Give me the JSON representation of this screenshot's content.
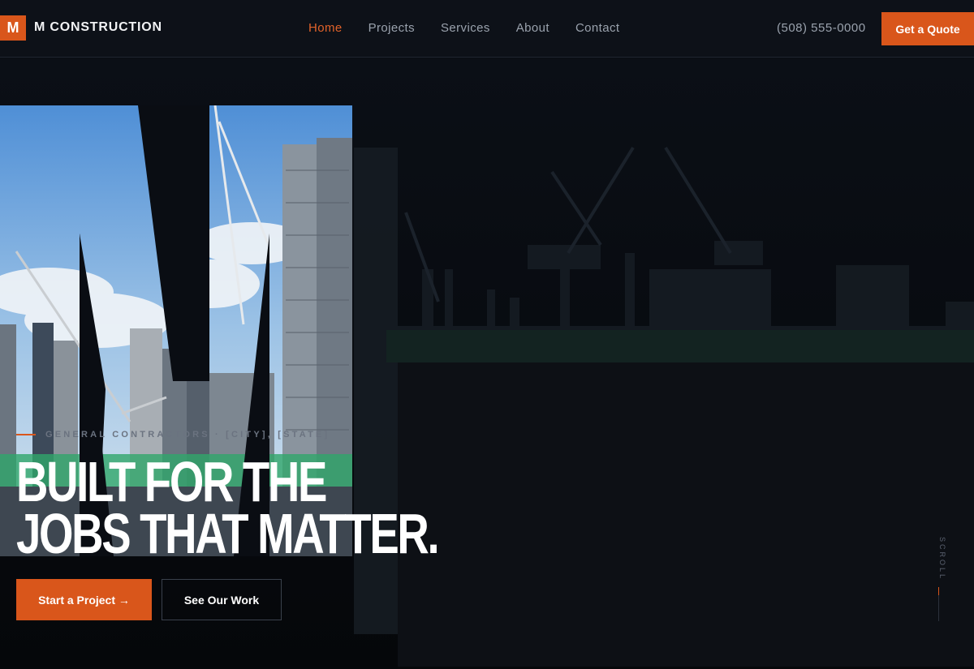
{
  "header": {
    "logo_letter": "M",
    "brand": "M CONSTRUCTION",
    "nav": [
      {
        "label": "Home",
        "active": true
      },
      {
        "label": "Projects",
        "active": false
      },
      {
        "label": "Services",
        "active": false
      },
      {
        "label": "About",
        "active": false
      },
      {
        "label": "Contact",
        "active": false
      }
    ],
    "phone": "(508) 555-0000",
    "cta_label": "Get a Quote"
  },
  "hero": {
    "eyebrow": "GENERAL CONTRACTORS · [CITY], [STATE]",
    "title_line1": "BUILT FOR THE",
    "title_line2": "JOBS THAT MATTER.",
    "primary_cta": "Start a Project →",
    "secondary_cta": "See Our Work",
    "scroll_label": "SCROLL"
  },
  "colors": {
    "accent": "#d9561b",
    "background": "#0a0d13",
    "nav_text": "#9aa2ad",
    "active_nav": "#e0622a"
  }
}
